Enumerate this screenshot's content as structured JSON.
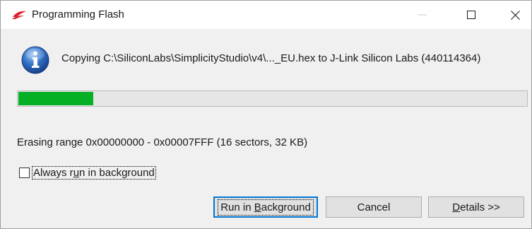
{
  "window": {
    "title": "Programming Flash",
    "minimize_icon": "minimize-icon",
    "maximize_icon": "maximize-icon",
    "close_icon": "close-icon",
    "app_icon": "silicon-labs-logo-icon"
  },
  "message": {
    "icon": "info-icon",
    "text": "Copying C:\\SiliconLabs\\SimplicityStudio\\v4\\..._EU.hex to J-Link Silicon Labs (440114364)"
  },
  "progress": {
    "percent": 15,
    "color": "#06b025"
  },
  "status": {
    "text": "Erasing range 0x00000000 - 0x00007FFF (16 sectors, 32 KB)"
  },
  "options": {
    "always_background": {
      "checked": false,
      "label_pre": "Always r",
      "label_mnemonic": "u",
      "label_post": "n in background"
    }
  },
  "buttons": {
    "run_in_background": {
      "pre": "Run in ",
      "mnemonic": "B",
      "post": "ackground"
    },
    "cancel": {
      "label": "Cancel"
    },
    "details": {
      "pre": "",
      "mnemonic": "D",
      "post": "etails >>"
    }
  }
}
